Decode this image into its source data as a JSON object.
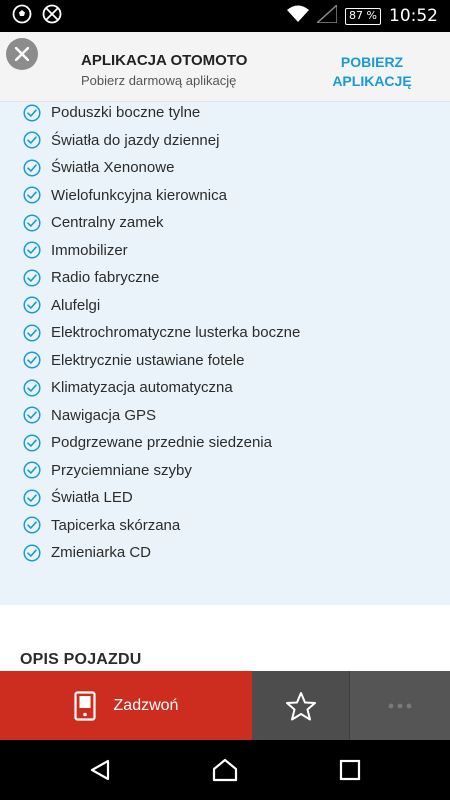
{
  "status_bar": {
    "time": "10:52",
    "battery": "87 %",
    "icons": [
      "soccer-ball-icon",
      "crossed-ball-icon",
      "wifi-icon",
      "signal-icon",
      "battery-icon"
    ]
  },
  "banner": {
    "title": "APLIKACJA OTOMOTO",
    "subtitle": "Pobierz darmową aplikację",
    "cta": "POBIERZ APLIKACJĘ"
  },
  "features": [
    "Poduszki boczne tylne",
    "Światła do jazdy dziennej",
    "Światła Xenonowe",
    "Wielofunkcyjna kierownica",
    "Centralny zamek",
    "Immobilizer",
    "Radio fabryczne",
    "Alufelgi",
    "Elektrochromatyczne lusterka boczne",
    "Elektrycznie ustawiane fotele",
    "Klimatyzacja automatyczna",
    "Nawigacja GPS",
    "Podgrzewane przednie siedzenia",
    "Przyciemniane szyby",
    "Światła LED",
    "Tapicerka skórzana",
    "Zmieniarka CD"
  ],
  "section": {
    "title": "OPIS POJAZDU"
  },
  "actions": {
    "call_label": "Zadzwoń",
    "call_icon": "phone-icon",
    "favorite_icon": "star-icon",
    "more_icon": "more-dots-icon"
  },
  "colors": {
    "accent_blue": "#1a9ad6",
    "call_red": "#cc2d1f",
    "features_bg": "#eaf3f9"
  }
}
